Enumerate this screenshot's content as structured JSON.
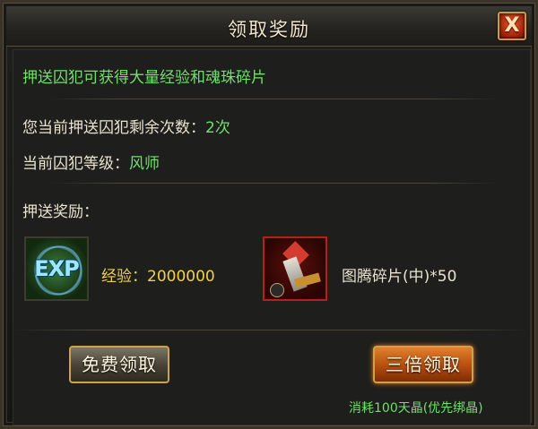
{
  "dialog": {
    "title": "领取奖励",
    "close_label": "X"
  },
  "info": {
    "intro": "押送囚犯可获得大量经验和魂珠碎片",
    "remaining_label": "您当前押送囚犯剩余次数：",
    "remaining_value": "2次",
    "level_label": "当前囚犯等级：",
    "level_value": "风师"
  },
  "rewards": {
    "heading": "押送奖励：",
    "exp_icon_text": "EXP",
    "exp_label": "经验：",
    "exp_value": "2000000",
    "item_label": "图腾碎片(中)*50"
  },
  "buttons": {
    "free_label": "免费领取",
    "triple_label": "三倍领取",
    "triple_cost": "消耗100天晶(优先绑晶)"
  },
  "colors": {
    "highlight_green": "#6fe06a",
    "exp_yellow": "#f1d14a",
    "triple_button": "#b54d10",
    "frame_gold": "#caa34b"
  }
}
